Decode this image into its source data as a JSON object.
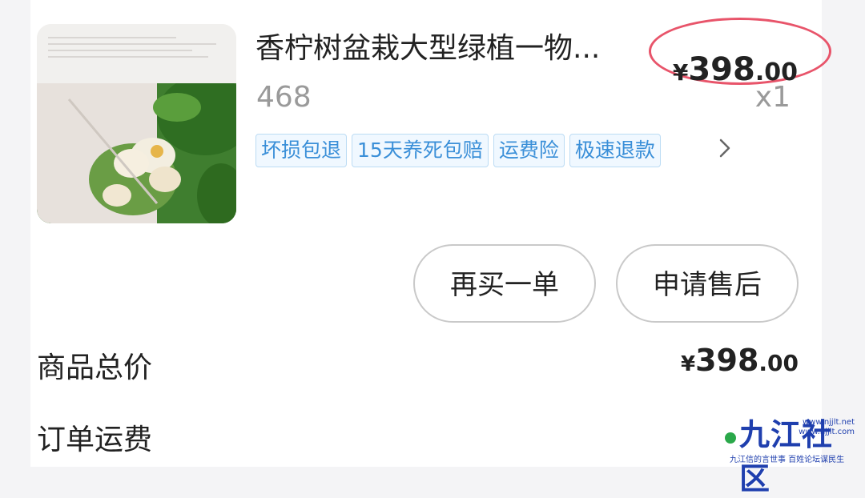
{
  "product": {
    "title": "香柠树盆栽大型绿植一物...",
    "spec": "468",
    "quantity": "x1",
    "price": {
      "symbol": "¥",
      "integer": "398",
      "decimal": ".00"
    },
    "tags": [
      "坏损包退",
      "15天养死包赔",
      "运费险",
      "极速退款"
    ],
    "tags_more_icon": "chevron-right-icon",
    "thumbnail_alt": "product-photo"
  },
  "actions": {
    "rebuy_label": "再买一单",
    "aftersale_label": "申请售后"
  },
  "summary": {
    "total_label": "商品总价",
    "total_price": {
      "symbol": "¥",
      "integer": "398",
      "decimal": ".00"
    },
    "shipping_label": "订单运费"
  },
  "watermark": {
    "logo_text": "九江社区",
    "url": "www.njjlt.net",
    "url2": "www.njjlt.com",
    "slogan": "九江信的言世事  百姓论坛谋民生"
  },
  "colors": {
    "highlight_oval": "#e8546a",
    "tag_text": "#3a8fd8",
    "tag_border": "#bcdcf4",
    "muted_text": "#9a9a9a"
  }
}
